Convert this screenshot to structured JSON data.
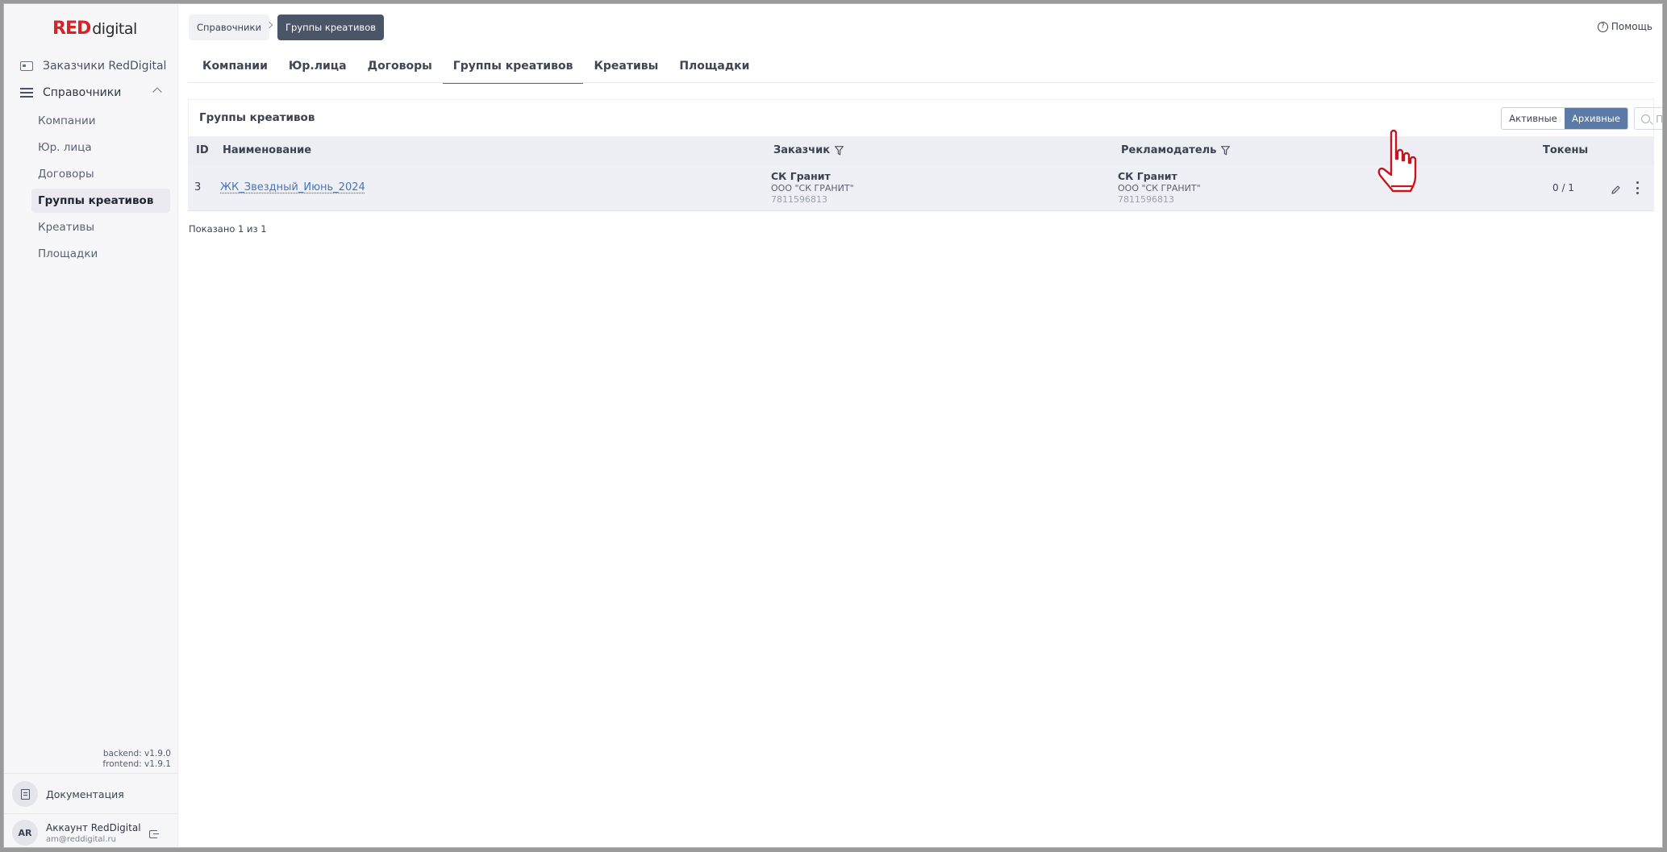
{
  "logo": {
    "red": "RED",
    "digital": "digital"
  },
  "sidebar": {
    "top_item": "Заказчики RedDigital",
    "group_label": "Справочники",
    "items": [
      {
        "label": "Компании"
      },
      {
        "label": "Юр. лица"
      },
      {
        "label": "Договоры"
      },
      {
        "label": "Группы креативов"
      },
      {
        "label": "Креативы"
      },
      {
        "label": "Площадки"
      }
    ],
    "active_index": 3,
    "backend_version": "backend: v1.9.0",
    "frontend_version": "frontend: v1.9.1",
    "docs_label": "Документация",
    "account": {
      "initials": "AR",
      "name": "Аккаунт RedDigital",
      "email": "am@reddigital.ru"
    }
  },
  "breadcrumb": {
    "parent": "Справочники",
    "current": "Группы креативов"
  },
  "help_label": "Помощь",
  "tabs": [
    {
      "label": "Компании"
    },
    {
      "label": "Юр.лица"
    },
    {
      "label": "Договоры"
    },
    {
      "label": "Группы креативов"
    },
    {
      "label": "Креативы"
    },
    {
      "label": "Площадки"
    }
  ],
  "active_tab": "Группы креативов",
  "card": {
    "title": "Группы креативов",
    "toggle": {
      "active": "Активные",
      "archived": "Архивные",
      "selected": "Архивные"
    },
    "search_placeholder": "Поиск по наименованию"
  },
  "table": {
    "columns": {
      "id": "ID",
      "name": "Наименование",
      "customer": "Заказчик",
      "advertiser": "Рекламодатель",
      "tokens": "Токены"
    },
    "rows": [
      {
        "id": "3",
        "name": "ЖК_Звездный_Июнь_2024",
        "customer": {
          "name": "СК Гранит",
          "legal": "ООО \"СК ГРАНИТ\"",
          "inn": "7811596813"
        },
        "advertiser": {
          "name": "СК Гранит",
          "legal": "ООО \"СК ГРАНИТ\"",
          "inn": "7811596813"
        },
        "tokens": "0 / 1"
      }
    ]
  },
  "footer_text": "Показано 1 из 1",
  "colors": {
    "accent": "#5b7aa6",
    "brand_red": "#d6232a",
    "link": "#4a74b4",
    "cursor_red": "#c8141e"
  }
}
